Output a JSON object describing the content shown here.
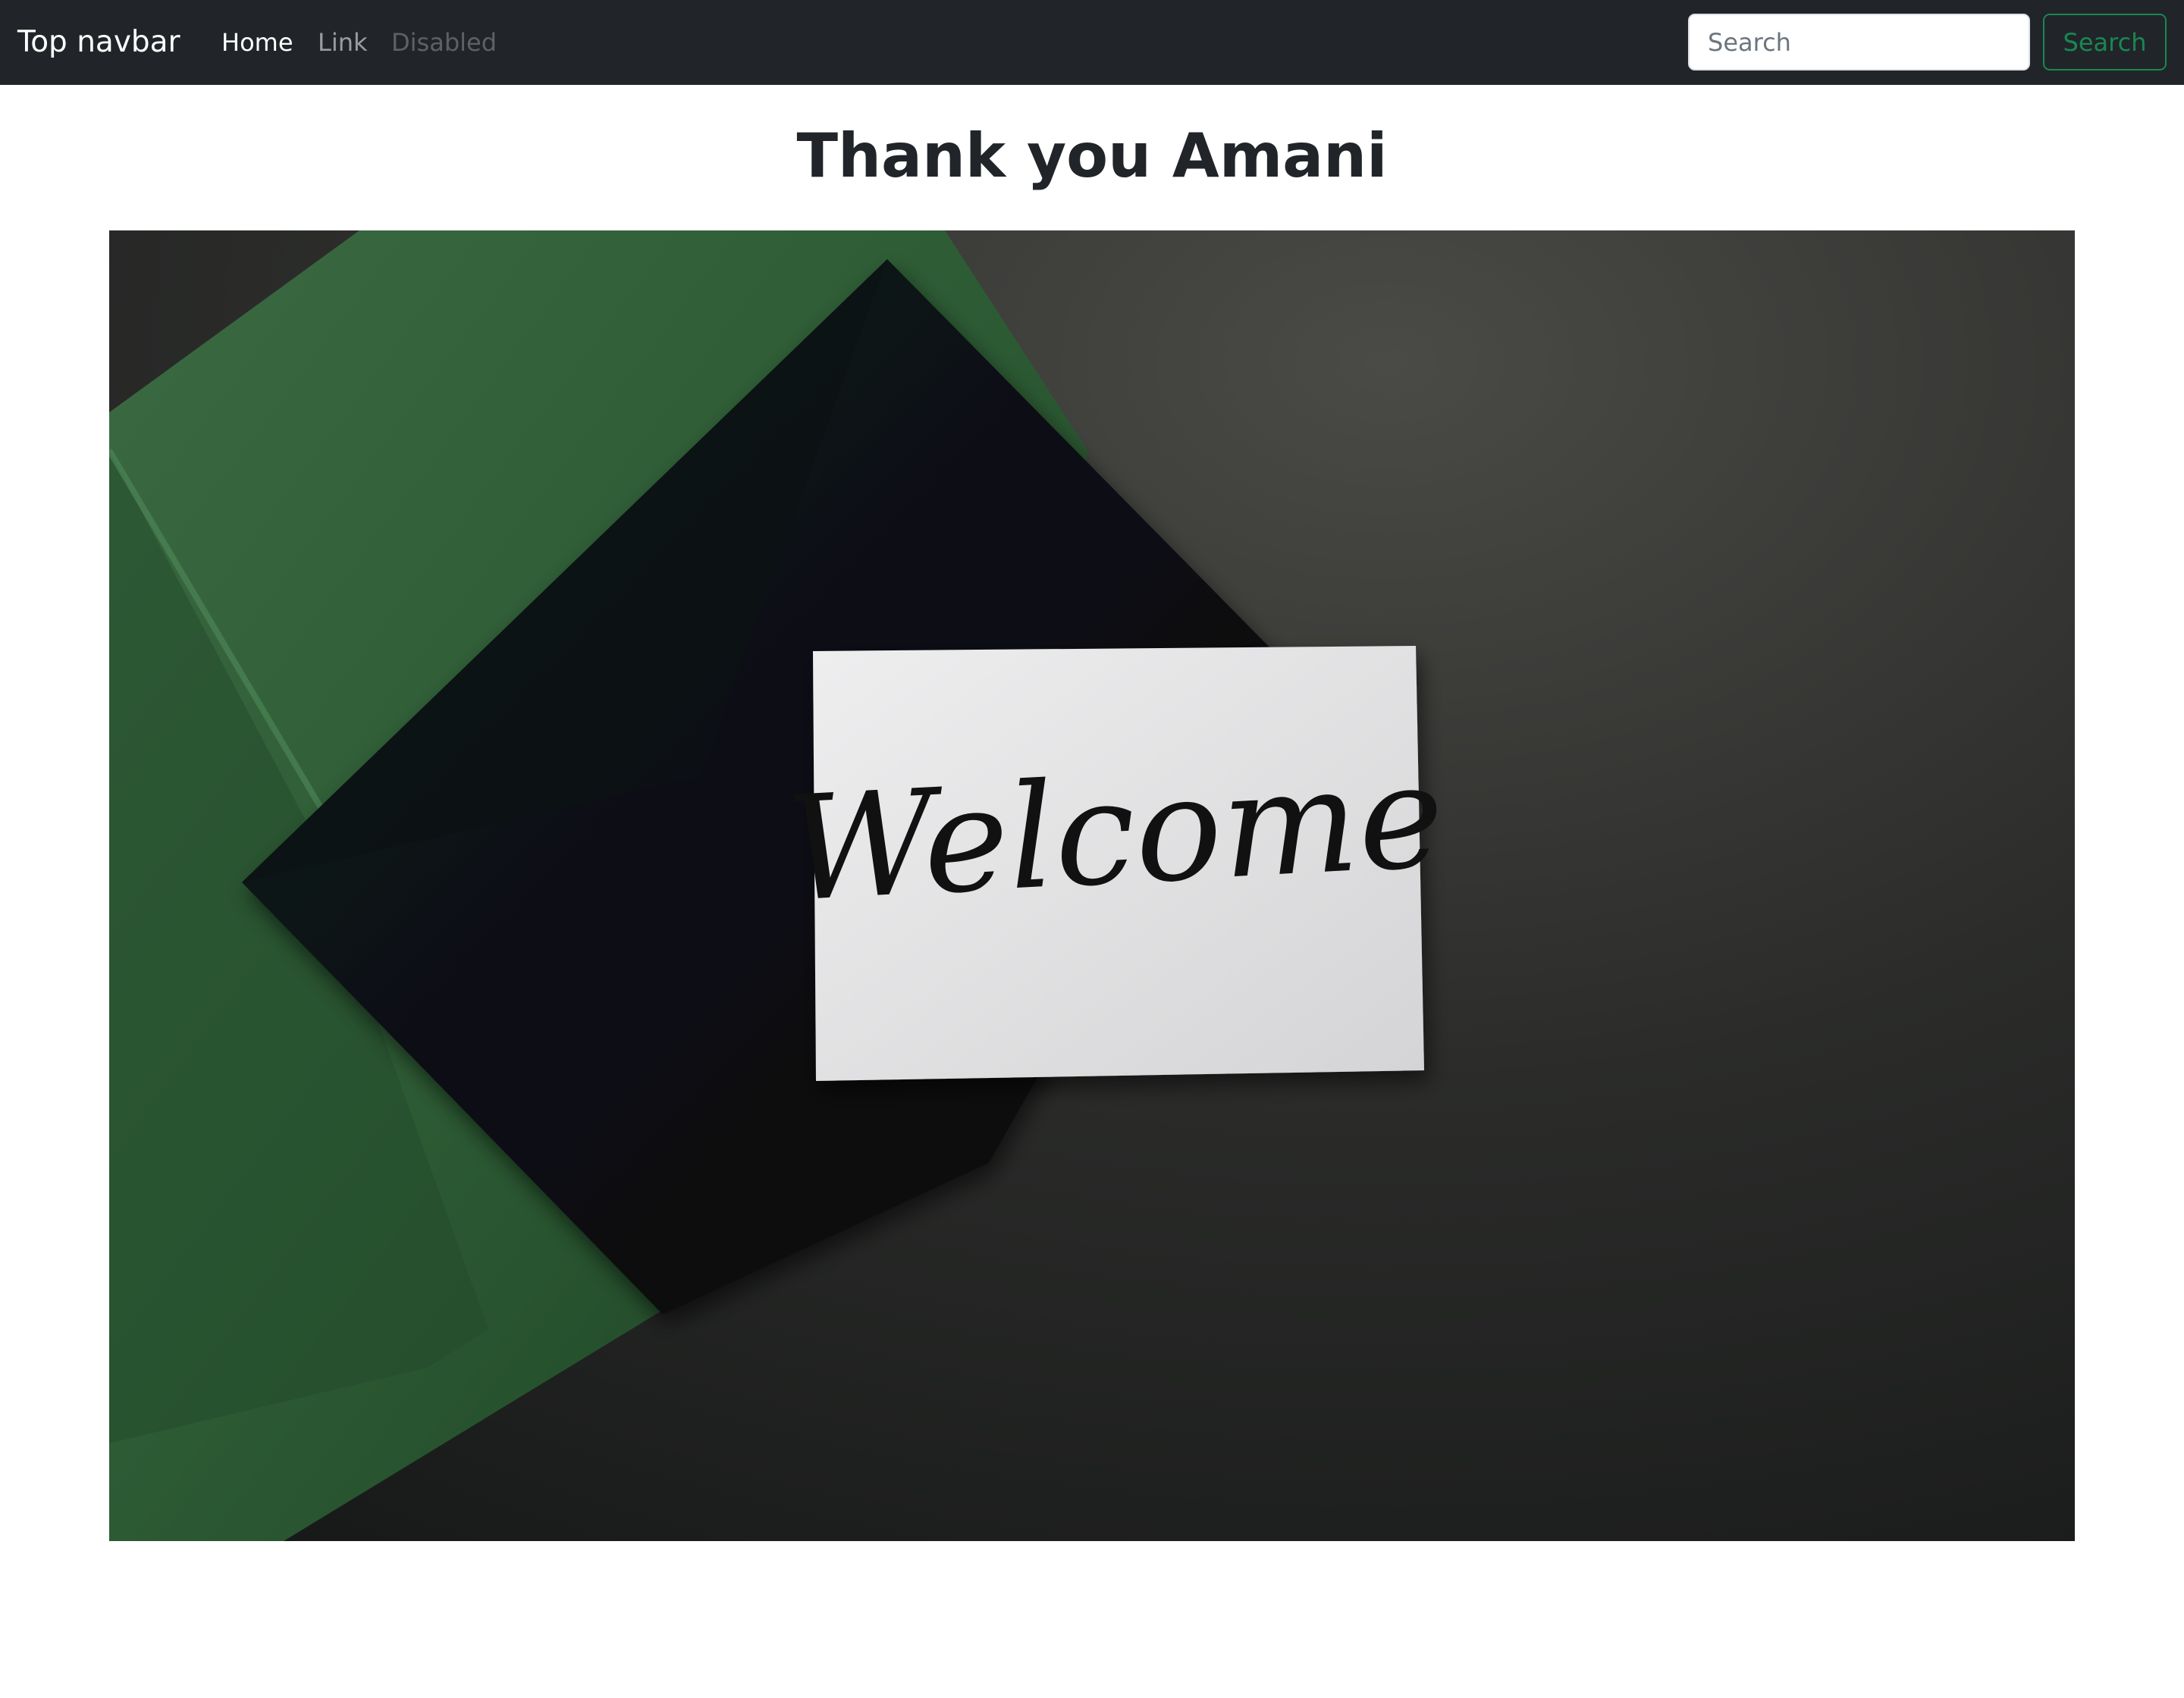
{
  "navbar": {
    "brand": "Top navbar",
    "links": [
      {
        "label": "Home",
        "state": "active"
      },
      {
        "label": "Link",
        "state": "normal"
      },
      {
        "label": "Disabled",
        "state": "disabled"
      }
    ],
    "search": {
      "placeholder": "Search",
      "value": "",
      "button_label": "Search"
    }
  },
  "main": {
    "title": "Thank you Amani",
    "hero_image": {
      "description": "Green book, black envelope and a white card on a dark textured surface",
      "card_text": "Welcome"
    }
  },
  "colors": {
    "navbar_bg": "#212529",
    "success": "#198754",
    "text": "#212529"
  }
}
